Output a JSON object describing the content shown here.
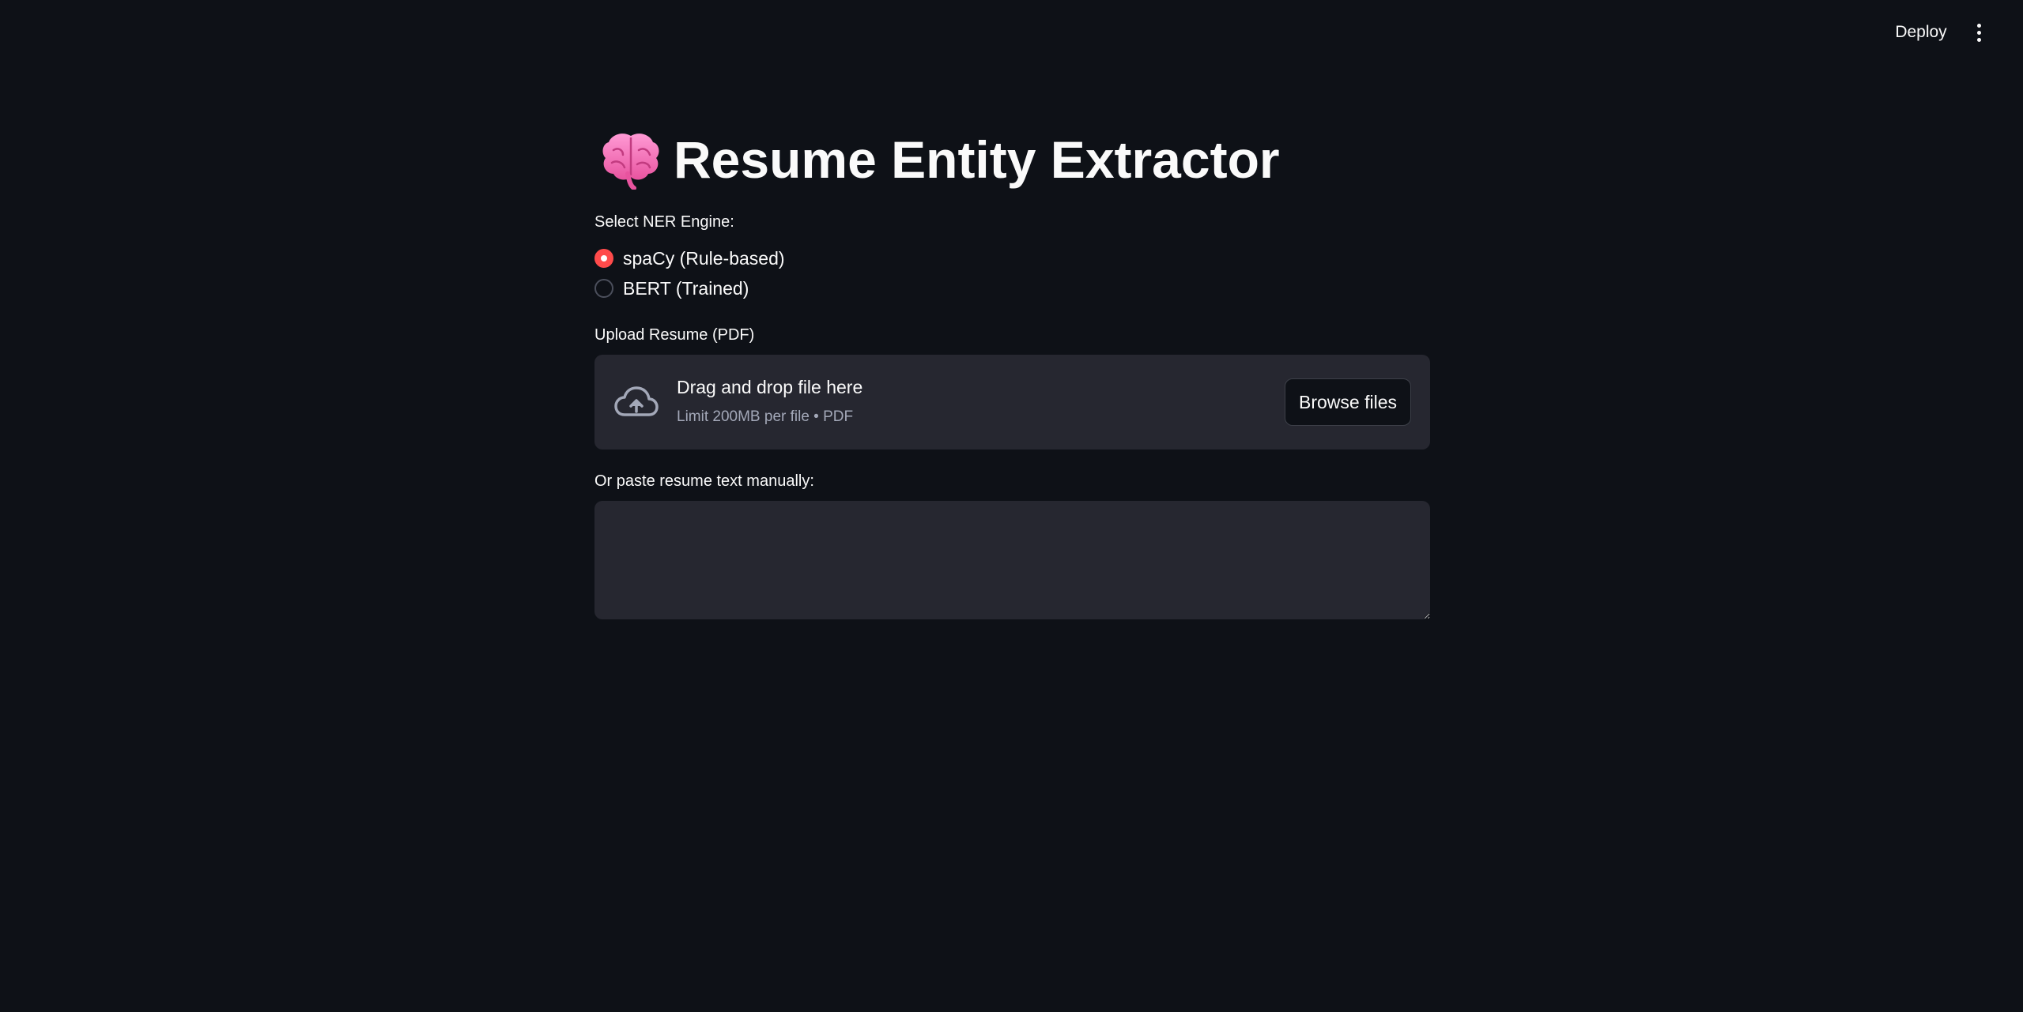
{
  "header": {
    "deploy_label": "Deploy",
    "menu_icon": "vertical-ellipsis-icon"
  },
  "main": {
    "title_icon": "brain-icon",
    "title": "Resume Entity Extractor",
    "ner_engine": {
      "label": "Select NER Engine:",
      "options": [
        {
          "label": "spaCy (Rule-based)",
          "selected": true
        },
        {
          "label": "BERT (Trained)",
          "selected": false
        }
      ]
    },
    "upload": {
      "label": "Upload Resume (PDF)",
      "icon": "cloud-upload-icon",
      "dropzone_title": "Drag and drop file here",
      "dropzone_subtitle": "Limit 200MB per file • PDF",
      "browse_label": "Browse files"
    },
    "paste": {
      "label": "Or paste resume text manually:",
      "value": ""
    }
  },
  "colors": {
    "background": "#0e1117",
    "surface": "#262730",
    "accent": "#ff4b4b",
    "text": "#fafafa",
    "muted_text": "#a3a8b8"
  }
}
